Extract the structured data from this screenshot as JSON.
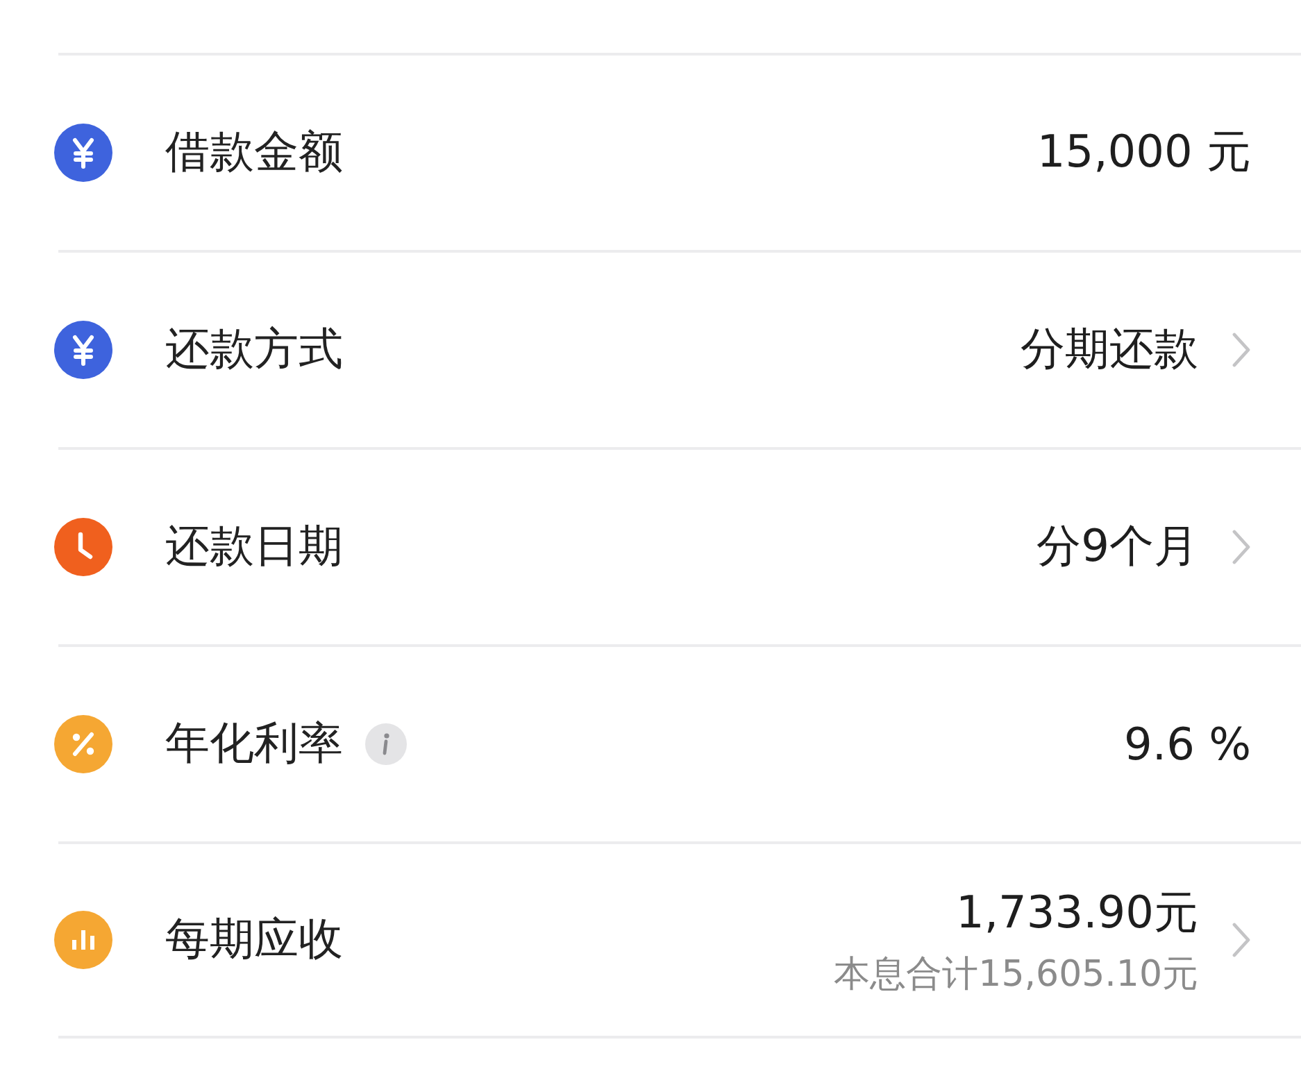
{
  "rows": [
    {
      "kind": "yuan",
      "color": "#3e63dd",
      "label": "借款金额",
      "info": false,
      "value": "15,000 元",
      "chevron": false
    },
    {
      "kind": "yuan",
      "color": "#3e63dd",
      "label": "还款方式",
      "info": false,
      "value": "分期还款",
      "chevron": true
    },
    {
      "kind": "clock",
      "color": "#f0601e",
      "label": "还款日期",
      "info": false,
      "value": "分9个月",
      "chevron": true
    },
    {
      "kind": "percent",
      "color": "#f5a733",
      "label": "年化利率",
      "info": true,
      "value": "9.6 %",
      "chevron": false
    },
    {
      "kind": "bars",
      "color": "#f5a733",
      "label": "每期应收",
      "info": false,
      "value": "1,733.90元",
      "subvalue": "本息合计15,605.10元",
      "chevron": true
    }
  ]
}
